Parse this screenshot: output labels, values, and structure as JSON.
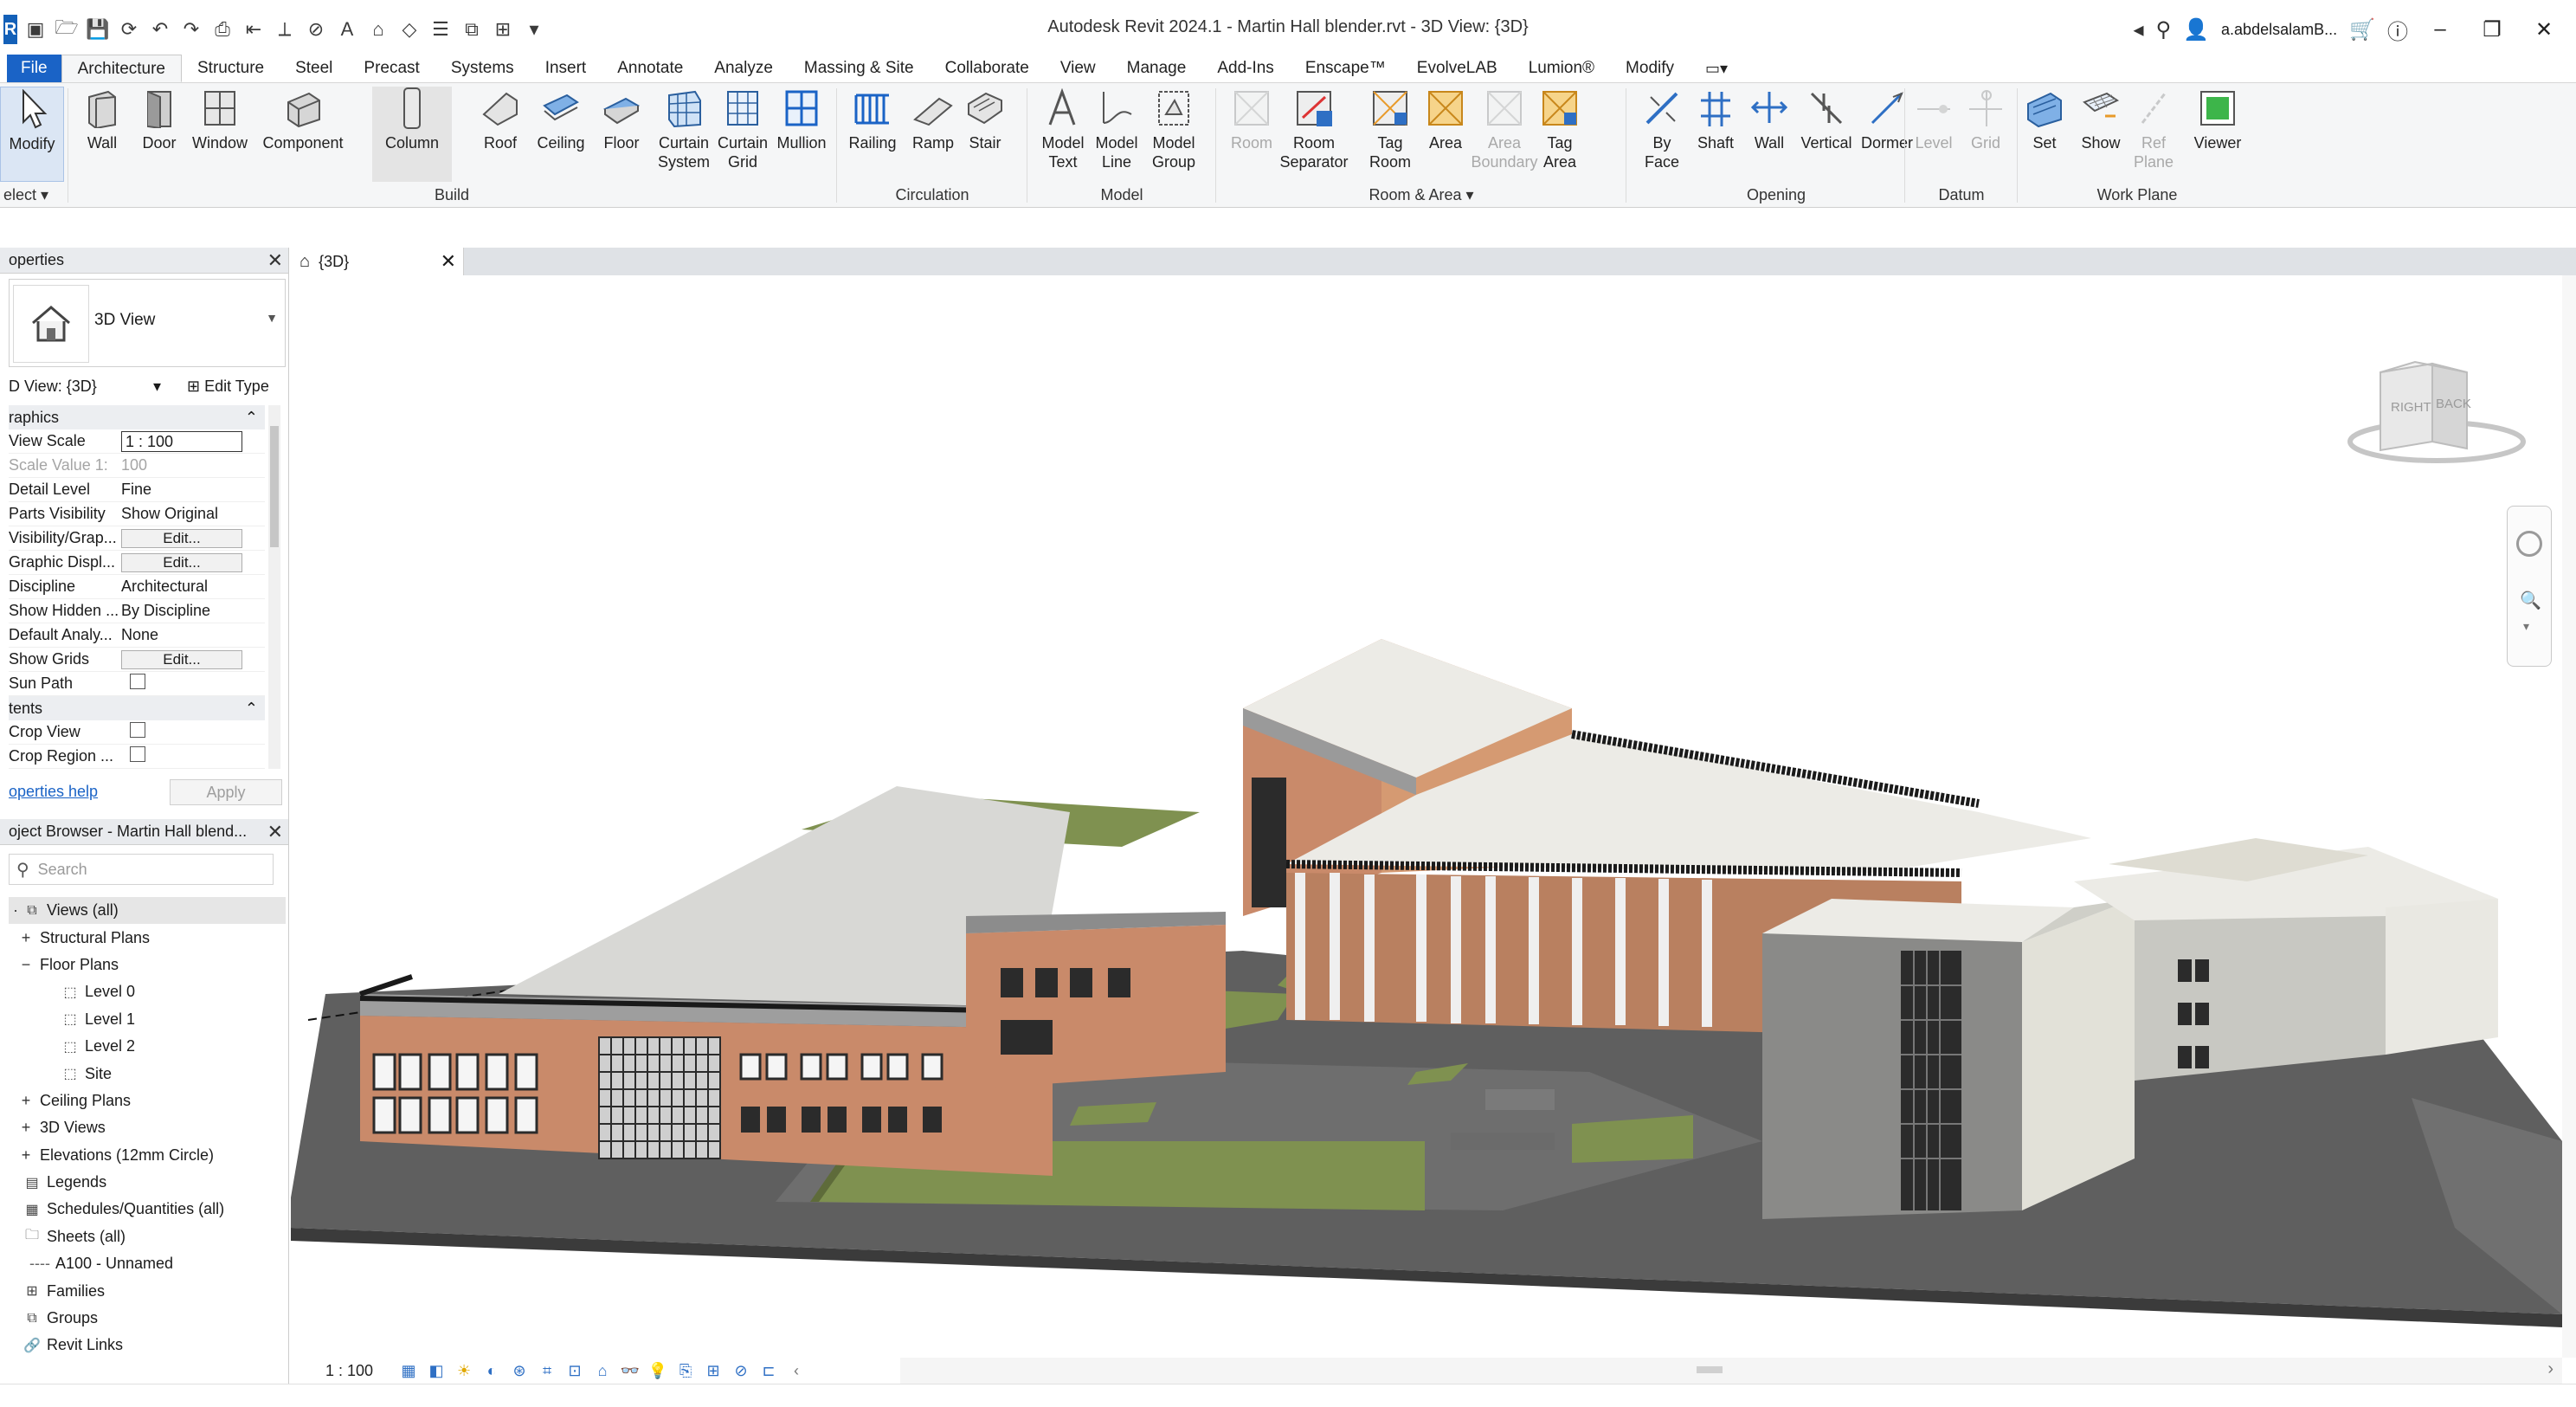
{
  "window": {
    "title": "Autodesk Revit 2024.1 - Martin Hall blender.rvt - 3D View: {3D}",
    "user": "a.abdelsalamB...",
    "badge": "R"
  },
  "ribbon_tabs": [
    "File",
    "Architecture",
    "Structure",
    "Steel",
    "Precast",
    "Systems",
    "Insert",
    "Annotate",
    "Analyze",
    "Massing & Site",
    "Collaborate",
    "View",
    "Manage",
    "Add-Ins",
    "Enscape™",
    "EvolveLAB",
    "Lumion®",
    "Modify"
  ],
  "ribbon": {
    "select": {
      "modify": "Modify",
      "select": "elect"
    },
    "build": {
      "label": "Build",
      "buttons": [
        "Wall",
        "Door",
        "Window",
        "Component",
        "Column",
        "Roof",
        "Ceiling",
        "Floor",
        "Curtain\nSystem",
        "Curtain\nGrid",
        "Mullion"
      ]
    },
    "circulation": {
      "label": "Circulation",
      "buttons": [
        "Railing",
        "Ramp",
        "Stair"
      ]
    },
    "model": {
      "label": "Model",
      "buttons": [
        "Model\nText",
        "Model\nLine",
        "Model\nGroup"
      ]
    },
    "room_area": {
      "label": "Room & Area",
      "buttons": [
        "Room",
        "Room\nSeparator",
        "Tag\nRoom",
        "Area",
        "Area\nBoundary",
        "Tag\nArea"
      ]
    },
    "opening": {
      "label": "Opening",
      "buttons": [
        "By\nFace",
        "Shaft",
        "Wall",
        "Vertical",
        "Dormer"
      ]
    },
    "datum": {
      "label": "Datum",
      "buttons": [
        "Level",
        "Grid"
      ]
    },
    "work_plane": {
      "label": "Work Plane",
      "buttons": [
        "Set",
        "Show",
        "Ref\nPlane",
        "Viewer"
      ]
    }
  },
  "properties": {
    "title": "operties",
    "type_name": "3D View",
    "view_selector": "D View: {3D}",
    "edit_type": "Edit Type",
    "categories": {
      "graphics": "raphics",
      "extents": "tents"
    },
    "rows": [
      {
        "name": "View Scale",
        "value": "1 : 100"
      },
      {
        "name": "Scale Value    1:",
        "value": "100"
      },
      {
        "name": "Detail Level",
        "value": "Fine"
      },
      {
        "name": "Parts Visibility",
        "value": "Show Original"
      },
      {
        "name": "Visibility/Grap...",
        "value": "Edit..."
      },
      {
        "name": "Graphic Displ...",
        "value": "Edit..."
      },
      {
        "name": "Discipline",
        "value": "Architectural"
      },
      {
        "name": "Show Hidden ...",
        "value": "By Discipline"
      },
      {
        "name": "Default Analy...",
        "value": "None"
      },
      {
        "name": "Show Grids",
        "value": "Edit..."
      },
      {
        "name": "Sun Path",
        "value": ""
      }
    ],
    "extents_rows": [
      {
        "name": "Crop View",
        "value": ""
      },
      {
        "name": "Crop Region ...",
        "value": ""
      }
    ],
    "help_link": "operties help",
    "apply": "Apply"
  },
  "browser": {
    "title": "oject Browser - Martin Hall blend...",
    "search_placeholder": "Search",
    "nodes": [
      {
        "label": "Views (all)",
        "exp": "-",
        "level": 0
      },
      {
        "label": "Structural Plans",
        "exp": "+",
        "level": 1
      },
      {
        "label": "Floor Plans",
        "exp": "−",
        "level": 1
      },
      {
        "label": "Level 0",
        "exp": "",
        "level": 2
      },
      {
        "label": "Level 1",
        "exp": "",
        "level": 2
      },
      {
        "label": "Level 2",
        "exp": "",
        "level": 2
      },
      {
        "label": "Site",
        "exp": "",
        "level": 2
      },
      {
        "label": "Ceiling Plans",
        "exp": "+",
        "level": 1
      },
      {
        "label": "3D Views",
        "exp": "+",
        "level": 1
      },
      {
        "label": "Elevations (12mm Circle)",
        "exp": "+",
        "level": 1
      },
      {
        "label": "Legends",
        "exp": "",
        "level": 0
      },
      {
        "label": "Schedules/Quantities (all)",
        "exp": "",
        "level": 0
      },
      {
        "label": "Sheets (all)",
        "exp": "",
        "level": 0
      },
      {
        "label": "A100 - Unnamed",
        "exp": "",
        "level": 1
      },
      {
        "label": "Families",
        "exp": "",
        "level": 0
      },
      {
        "label": "Groups",
        "exp": "",
        "level": 0
      },
      {
        "label": "Revit Links",
        "exp": "",
        "level": 0
      }
    ]
  },
  "view": {
    "tab_label": "{3D}",
    "scale": "1 : 100",
    "viewcube": {
      "face1": "RIGHT",
      "face2": "BACK"
    }
  },
  "colors": {
    "accent": "#1a63c6",
    "brick": "#c98a6a",
    "roof_white": "#ecebe6",
    "grass": "#7f9150",
    "ground": "#616161",
    "gray_wall": "#8a8a88"
  }
}
